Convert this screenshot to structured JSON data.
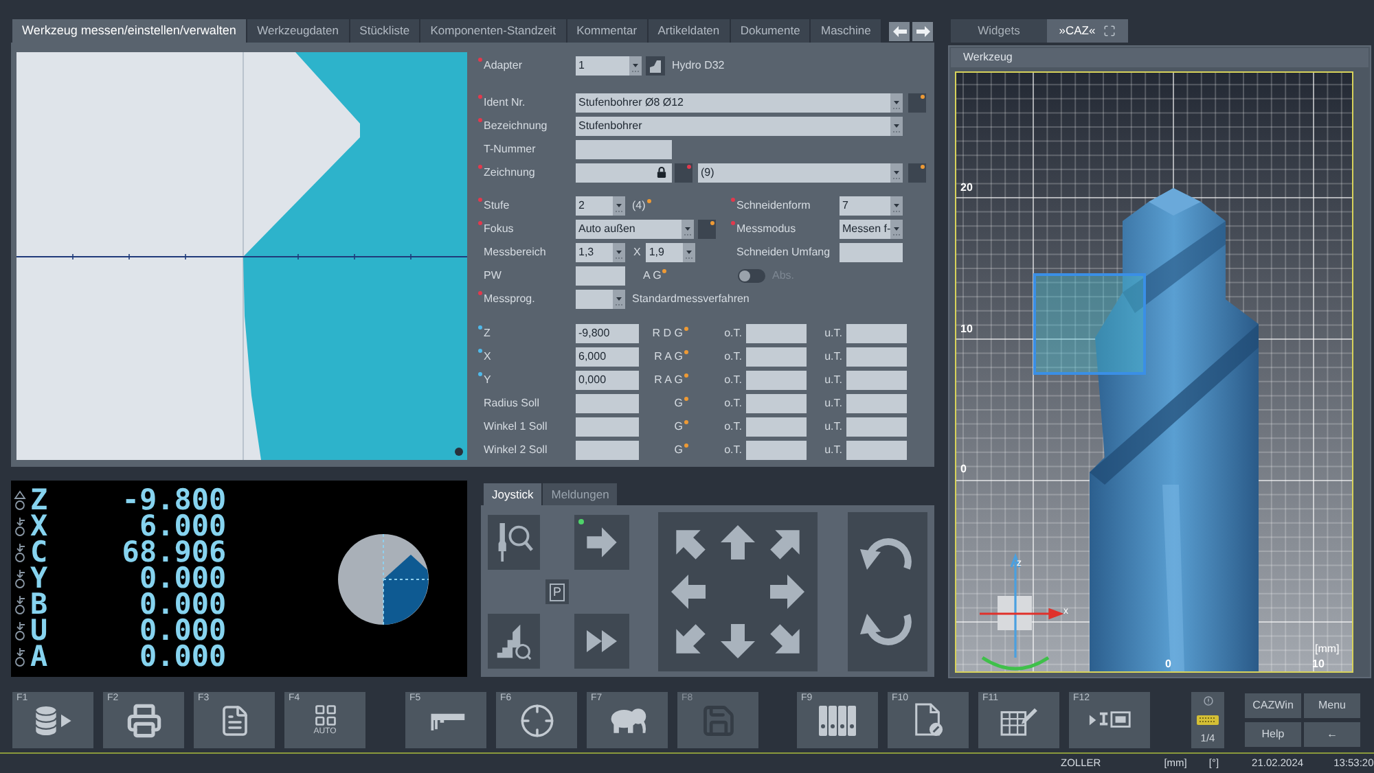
{
  "main_tabs": [
    {
      "label": "Werkzeug messen/einstellen/verwalten",
      "selected": true
    },
    {
      "label": "Werkzeugdaten",
      "selected": false
    },
    {
      "label": "Stückliste",
      "selected": false
    },
    {
      "label": "Komponenten-Standzeit",
      "selected": false
    },
    {
      "label": "Kommentar",
      "selected": false
    },
    {
      "label": "Artikeldaten",
      "selected": false
    },
    {
      "label": "Dokumente",
      "selected": false
    },
    {
      "label": "Maschine",
      "selected": false
    }
  ],
  "side_tabs": [
    {
      "label": "Widgets",
      "selected": false
    },
    {
      "label": "»CAZ«",
      "selected": true
    }
  ],
  "form": {
    "adapter": {
      "label": "Adapter",
      "required": true,
      "value": "1",
      "name": "Hydro D32"
    },
    "ident_nr": {
      "label": "Ident Nr.",
      "required": true,
      "value": "Stufenbohrer Ø8 Ø12",
      "note_flag": true
    },
    "bezeichnung": {
      "label": "Bezeichnung",
      "required": true,
      "value": "Stufenbohrer"
    },
    "t_nummer": {
      "label": "T-Nummer",
      "required": false
    },
    "zeichnung": {
      "label": "Zeichnung",
      "required": true,
      "locked": true,
      "variant_required": true,
      "variant": "(9)",
      "note_flag": true
    },
    "stufe": {
      "label": "Stufe",
      "required": true,
      "value": "2",
      "count": "(4)",
      "count_flagged": true
    },
    "schneidenform": {
      "label": "Schneidenform",
      "required": true,
      "value": "7"
    },
    "fokus": {
      "label": "Fokus",
      "required": true,
      "value": "Auto außen",
      "note_flag": true
    },
    "messmodus": {
      "label": "Messmodus",
      "required": true,
      "value": "Messen f-"
    },
    "messbereich": {
      "label": "Messbereich",
      "required": false,
      "from": "1,3",
      "separator": "X",
      "to": "1,9"
    },
    "schneiden_umfang": {
      "label": "Schneiden Umfang",
      "required": false
    },
    "pw": {
      "label": "PW",
      "required": false,
      "suffix": "A G",
      "flagged": true
    },
    "absolute": {
      "label": "Abs.",
      "on": false,
      "disabled": true
    },
    "messprog": {
      "label": "Messprog.",
      "required": true,
      "description": "Standardmessverfahren"
    },
    "measure_rows": [
      {
        "kind": "axis",
        "label": "Z",
        "value": "-9,800",
        "suffix": "R D G",
        "flagged": true,
        "upper": "o.T.",
        "lower": "u.T."
      },
      {
        "kind": "axis",
        "label": "X",
        "value": "6,000",
        "suffix": "R A G",
        "flagged": true,
        "upper": "o.T.",
        "lower": "u.T."
      },
      {
        "kind": "axis",
        "label": "Y",
        "value": "0,000",
        "suffix": "R A G",
        "flagged": true,
        "upper": "o.T.",
        "lower": "u.T."
      },
      {
        "kind": "target",
        "label": "Radius Soll",
        "suffix": "G",
        "flagged": true,
        "upper": "o.T.",
        "lower": "u.T."
      },
      {
        "kind": "target",
        "label": "Winkel 1 Soll",
        "suffix": "G",
        "flagged": true,
        "upper": "o.T.",
        "lower": "u.T."
      },
      {
        "kind": "target",
        "label": "Winkel 2 Soll",
        "suffix": "G",
        "flagged": true,
        "upper": "o.T.",
        "lower": "u.T."
      }
    ]
  },
  "position_display": {
    "axes": [
      {
        "axis": "Z",
        "value": "-9.800",
        "kind": "delta"
      },
      {
        "axis": "X",
        "value": "6.000",
        "kind": "arrow"
      },
      {
        "axis": "C",
        "value": "68.906",
        "kind": "arrow"
      },
      {
        "axis": "Y",
        "value": "0.000",
        "kind": "arrow"
      },
      {
        "axis": "B",
        "value": "0.000",
        "kind": "arrow"
      },
      {
        "axis": "U",
        "value": "0.000",
        "kind": "arrow"
      },
      {
        "axis": "A",
        "value": "0.000",
        "kind": "arrow"
      }
    ]
  },
  "joystick": {
    "tabs": [
      {
        "label": "Joystick",
        "selected": true
      },
      {
        "label": "Meldungen",
        "selected": false
      }
    ],
    "feed_active": true,
    "park": "P"
  },
  "viewer": {
    "title": "Werkzeug",
    "z_labels": [
      "20",
      "10",
      "0"
    ],
    "x_labels": [
      "0",
      "10"
    ],
    "unit": "[mm]",
    "triad": [
      "z",
      "x"
    ]
  },
  "function_keys": [
    {
      "key": "F1",
      "kind": "database",
      "disabled": false
    },
    {
      "key": "F2",
      "kind": "printer",
      "disabled": false
    },
    {
      "key": "F3",
      "kind": "list",
      "disabled": false
    },
    {
      "key": "F4",
      "kind": "grid",
      "caption": "AUTO",
      "disabled": false
    },
    {
      "key": "F5",
      "kind": "caliper",
      "disabled": false
    },
    {
      "key": "F6",
      "kind": "crosshair",
      "disabled": false
    },
    {
      "key": "F7",
      "kind": "elephant",
      "disabled": false
    },
    {
      "key": "F8",
      "kind": "disk",
      "disabled": true
    },
    {
      "key": "F9",
      "kind": "binders",
      "disabled": false
    },
    {
      "key": "F10",
      "kind": "document",
      "disabled": false
    },
    {
      "key": "F11",
      "kind": "table",
      "disabled": false
    },
    {
      "key": "F12",
      "kind": "device",
      "disabled": false
    }
  ],
  "page_indicator": "1/4",
  "system_buttons": [
    "CAZWin",
    "Menu",
    "Help",
    "←"
  ],
  "status_bar": [
    "ZOLLER",
    "[mm]",
    "[°]",
    "21.02.2024",
    "13:53:20"
  ]
}
